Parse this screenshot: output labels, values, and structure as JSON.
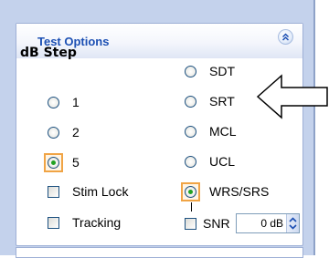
{
  "panel": {
    "title": "Test Options",
    "collapse_icon": "double-chevron-up-icon"
  },
  "db_step": {
    "label": "dB Step",
    "options": [
      {
        "label": "1",
        "checked": false
      },
      {
        "label": "2",
        "checked": false
      },
      {
        "label": "5",
        "checked": true
      }
    ]
  },
  "tests": {
    "options": [
      {
        "label": "SDT",
        "checked": false
      },
      {
        "label": "SRT",
        "checked": false
      },
      {
        "label": "MCL",
        "checked": false
      },
      {
        "label": "UCL",
        "checked": false
      },
      {
        "label": "WRS/SRS",
        "checked": true
      }
    ]
  },
  "checkboxes": {
    "stim_lock": {
      "label": "Stim Lock",
      "checked": false
    },
    "tracking": {
      "label": "Tracking",
      "checked": false
    },
    "snr": {
      "label": "SNR",
      "checked": false
    }
  },
  "snr_spinner": {
    "value": "0 dB"
  },
  "annotation": {
    "icon": "hollow-left-arrow-icon"
  },
  "colors": {
    "frame": "#c4d2ec",
    "title": "#1b4fb3",
    "focus": "#f0a445",
    "radio_dot": "#21a121"
  }
}
